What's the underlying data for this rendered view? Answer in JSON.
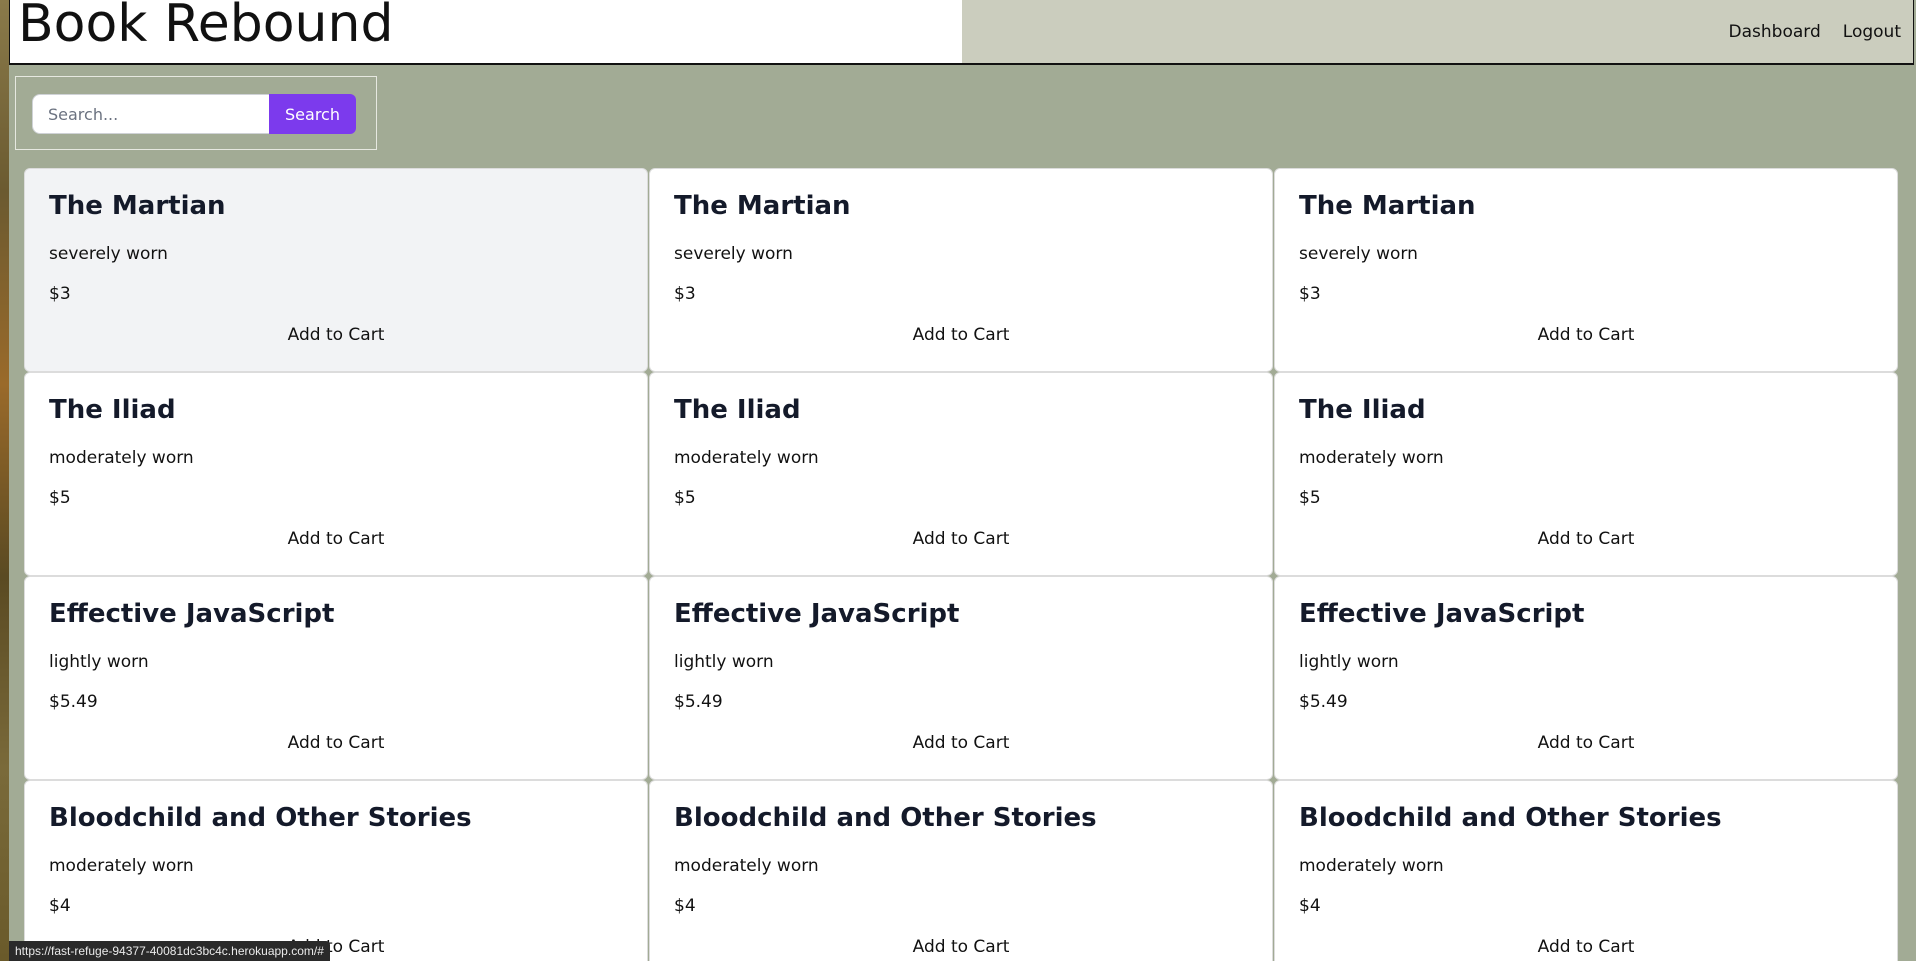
{
  "header": {
    "title": "Book Rebound",
    "nav": [
      "Dashboard",
      "Logout"
    ]
  },
  "search": {
    "placeholder": "Search...",
    "button_label": "Search"
  },
  "books": [
    {
      "title": "The Martian",
      "condition": "severely worn",
      "price": "$3",
      "button": "Add to Cart"
    },
    {
      "title": "The Martian",
      "condition": "severely worn",
      "price": "$3",
      "button": "Add to Cart"
    },
    {
      "title": "The Martian",
      "condition": "severely worn",
      "price": "$3",
      "button": "Add to Cart"
    },
    {
      "title": "The Iliad",
      "condition": "moderately worn",
      "price": "$5",
      "button": "Add to Cart"
    },
    {
      "title": "The Iliad",
      "condition": "moderately worn",
      "price": "$5",
      "button": "Add to Cart"
    },
    {
      "title": "The Iliad",
      "condition": "moderately worn",
      "price": "$5",
      "button": "Add to Cart"
    },
    {
      "title": "Effective JavaScript",
      "condition": "lightly worn",
      "price": "$5.49",
      "button": "Add to Cart"
    },
    {
      "title": "Effective JavaScript",
      "condition": "lightly worn",
      "price": "$5.49",
      "button": "Add to Cart"
    },
    {
      "title": "Effective JavaScript",
      "condition": "lightly worn",
      "price": "$5.49",
      "button": "Add to Cart"
    },
    {
      "title": "Bloodchild and Other Stories",
      "condition": "moderately worn",
      "price": "$4",
      "button": "Add to Cart"
    },
    {
      "title": "Bloodchild and Other Stories",
      "condition": "moderately worn",
      "price": "$4",
      "button": "Add to Cart"
    },
    {
      "title": "Bloodchild and Other Stories",
      "condition": "moderately worn",
      "price": "$4",
      "button": "Add to Cart"
    }
  ],
  "status_bar": {
    "url": "https://fast-refuge-94377-40081dc3bc4c.herokuapp.com/#"
  },
  "colors": {
    "page_background": "#a2ab95",
    "header_background": "#cbcdbe",
    "accent": "#7c3aed",
    "card_hover": "#f2f3f5"
  }
}
